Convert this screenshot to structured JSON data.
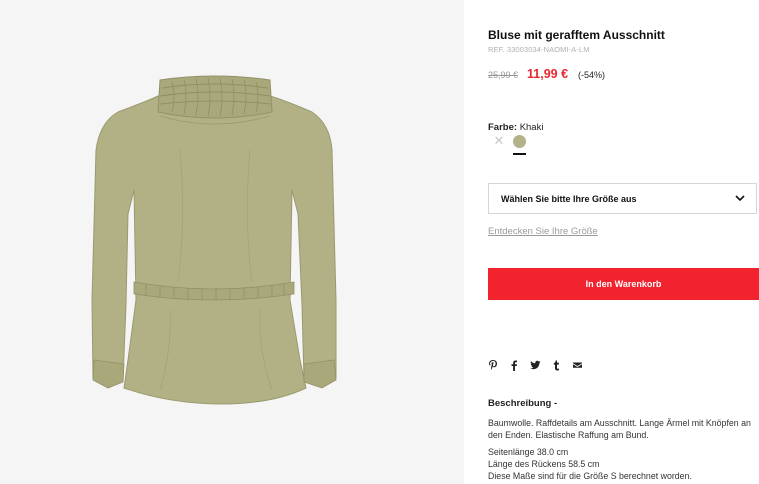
{
  "product": {
    "title": "Bluse mit gerafftem Ausschnitt",
    "ref": "REF. 33003034-NAOMI-A-LM",
    "old_price": "25,99 €",
    "new_price": "11,99 €",
    "discount": "(-54%)",
    "image_alt": "product-image-blouse"
  },
  "color": {
    "label": "Farbe:",
    "value": "Khaki",
    "swatch_color": "#b3b28a",
    "unavailable_icon": "close-x-icon"
  },
  "size": {
    "placeholder": "Wählen Sie bitte Ihre Größe aus",
    "icon": "chevron-down-icon",
    "guide_link": "Entdecken Sie Ihre Größe"
  },
  "cart": {
    "button_label": "In den Warenkorb",
    "button_color": "#f1232e"
  },
  "share": {
    "icons": [
      "pinterest-icon",
      "facebook-icon",
      "twitter-icon",
      "tumblr-icon",
      "email-icon"
    ]
  },
  "description": {
    "title": "Beschreibung -",
    "paragraph1": "Baumwolle. Raffdetails am Ausschnitt. Lange Ärmel mit Knöpfen an den Enden. Elastische Raffung am Bund.",
    "line1": "Seitenlänge 38.0 cm",
    "line2": "Länge des Rückens 58.5 cm",
    "line3": "Diese Maße sind für die Größe S berechnet worden."
  }
}
